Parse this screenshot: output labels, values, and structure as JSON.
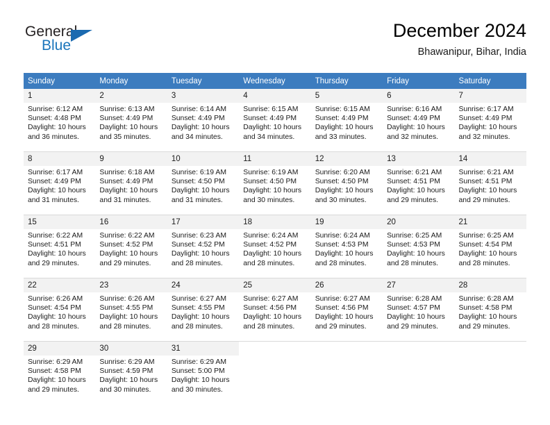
{
  "brand": {
    "word_general": "General",
    "word_blue": "Blue",
    "triangle_color": "#1b6ab0",
    "blue_color": "#1b75bb"
  },
  "header": {
    "title": "December 2024",
    "subtitle": "Bhawanipur, Bihar, India"
  },
  "theme": {
    "header_row_bg": "#3c7cbf",
    "daynum_bg": "#f2f2f2",
    "grid_line": "#d9d9d9",
    "text": "#1a1a1a"
  },
  "weekday_headers": [
    "Sunday",
    "Monday",
    "Tuesday",
    "Wednesday",
    "Thursday",
    "Friday",
    "Saturday"
  ],
  "labels": {
    "sunrise_prefix": "Sunrise:",
    "sunset_prefix": "Sunset:",
    "daylight_prefix": "Daylight:"
  },
  "weeks": [
    [
      {
        "day": "1",
        "sunrise": "Sunrise: 6:12 AM",
        "sunset": "Sunset: 4:48 PM",
        "daylight1": "Daylight: 10 hours",
        "daylight2": "and 36 minutes."
      },
      {
        "day": "2",
        "sunrise": "Sunrise: 6:13 AM",
        "sunset": "Sunset: 4:49 PM",
        "daylight1": "Daylight: 10 hours",
        "daylight2": "and 35 minutes."
      },
      {
        "day": "3",
        "sunrise": "Sunrise: 6:14 AM",
        "sunset": "Sunset: 4:49 PM",
        "daylight1": "Daylight: 10 hours",
        "daylight2": "and 34 minutes."
      },
      {
        "day": "4",
        "sunrise": "Sunrise: 6:15 AM",
        "sunset": "Sunset: 4:49 PM",
        "daylight1": "Daylight: 10 hours",
        "daylight2": "and 34 minutes."
      },
      {
        "day": "5",
        "sunrise": "Sunrise: 6:15 AM",
        "sunset": "Sunset: 4:49 PM",
        "daylight1": "Daylight: 10 hours",
        "daylight2": "and 33 minutes."
      },
      {
        "day": "6",
        "sunrise": "Sunrise: 6:16 AM",
        "sunset": "Sunset: 4:49 PM",
        "daylight1": "Daylight: 10 hours",
        "daylight2": "and 32 minutes."
      },
      {
        "day": "7",
        "sunrise": "Sunrise: 6:17 AM",
        "sunset": "Sunset: 4:49 PM",
        "daylight1": "Daylight: 10 hours",
        "daylight2": "and 32 minutes."
      }
    ],
    [
      {
        "day": "8",
        "sunrise": "Sunrise: 6:17 AM",
        "sunset": "Sunset: 4:49 PM",
        "daylight1": "Daylight: 10 hours",
        "daylight2": "and 31 minutes."
      },
      {
        "day": "9",
        "sunrise": "Sunrise: 6:18 AM",
        "sunset": "Sunset: 4:49 PM",
        "daylight1": "Daylight: 10 hours",
        "daylight2": "and 31 minutes."
      },
      {
        "day": "10",
        "sunrise": "Sunrise: 6:19 AM",
        "sunset": "Sunset: 4:50 PM",
        "daylight1": "Daylight: 10 hours",
        "daylight2": "and 31 minutes."
      },
      {
        "day": "11",
        "sunrise": "Sunrise: 6:19 AM",
        "sunset": "Sunset: 4:50 PM",
        "daylight1": "Daylight: 10 hours",
        "daylight2": "and 30 minutes."
      },
      {
        "day": "12",
        "sunrise": "Sunrise: 6:20 AM",
        "sunset": "Sunset: 4:50 PM",
        "daylight1": "Daylight: 10 hours",
        "daylight2": "and 30 minutes."
      },
      {
        "day": "13",
        "sunrise": "Sunrise: 6:21 AM",
        "sunset": "Sunset: 4:51 PM",
        "daylight1": "Daylight: 10 hours",
        "daylight2": "and 29 minutes."
      },
      {
        "day": "14",
        "sunrise": "Sunrise: 6:21 AM",
        "sunset": "Sunset: 4:51 PM",
        "daylight1": "Daylight: 10 hours",
        "daylight2": "and 29 minutes."
      }
    ],
    [
      {
        "day": "15",
        "sunrise": "Sunrise: 6:22 AM",
        "sunset": "Sunset: 4:51 PM",
        "daylight1": "Daylight: 10 hours",
        "daylight2": "and 29 minutes."
      },
      {
        "day": "16",
        "sunrise": "Sunrise: 6:22 AM",
        "sunset": "Sunset: 4:52 PM",
        "daylight1": "Daylight: 10 hours",
        "daylight2": "and 29 minutes."
      },
      {
        "day": "17",
        "sunrise": "Sunrise: 6:23 AM",
        "sunset": "Sunset: 4:52 PM",
        "daylight1": "Daylight: 10 hours",
        "daylight2": "and 28 minutes."
      },
      {
        "day": "18",
        "sunrise": "Sunrise: 6:24 AM",
        "sunset": "Sunset: 4:52 PM",
        "daylight1": "Daylight: 10 hours",
        "daylight2": "and 28 minutes."
      },
      {
        "day": "19",
        "sunrise": "Sunrise: 6:24 AM",
        "sunset": "Sunset: 4:53 PM",
        "daylight1": "Daylight: 10 hours",
        "daylight2": "and 28 minutes."
      },
      {
        "day": "20",
        "sunrise": "Sunrise: 6:25 AM",
        "sunset": "Sunset: 4:53 PM",
        "daylight1": "Daylight: 10 hours",
        "daylight2": "and 28 minutes."
      },
      {
        "day": "21",
        "sunrise": "Sunrise: 6:25 AM",
        "sunset": "Sunset: 4:54 PM",
        "daylight1": "Daylight: 10 hours",
        "daylight2": "and 28 minutes."
      }
    ],
    [
      {
        "day": "22",
        "sunrise": "Sunrise: 6:26 AM",
        "sunset": "Sunset: 4:54 PM",
        "daylight1": "Daylight: 10 hours",
        "daylight2": "and 28 minutes."
      },
      {
        "day": "23",
        "sunrise": "Sunrise: 6:26 AM",
        "sunset": "Sunset: 4:55 PM",
        "daylight1": "Daylight: 10 hours",
        "daylight2": "and 28 minutes."
      },
      {
        "day": "24",
        "sunrise": "Sunrise: 6:27 AM",
        "sunset": "Sunset: 4:55 PM",
        "daylight1": "Daylight: 10 hours",
        "daylight2": "and 28 minutes."
      },
      {
        "day": "25",
        "sunrise": "Sunrise: 6:27 AM",
        "sunset": "Sunset: 4:56 PM",
        "daylight1": "Daylight: 10 hours",
        "daylight2": "and 28 minutes."
      },
      {
        "day": "26",
        "sunrise": "Sunrise: 6:27 AM",
        "sunset": "Sunset: 4:56 PM",
        "daylight1": "Daylight: 10 hours",
        "daylight2": "and 29 minutes."
      },
      {
        "day": "27",
        "sunrise": "Sunrise: 6:28 AM",
        "sunset": "Sunset: 4:57 PM",
        "daylight1": "Daylight: 10 hours",
        "daylight2": "and 29 minutes."
      },
      {
        "day": "28",
        "sunrise": "Sunrise: 6:28 AM",
        "sunset": "Sunset: 4:58 PM",
        "daylight1": "Daylight: 10 hours",
        "daylight2": "and 29 minutes."
      }
    ],
    [
      {
        "day": "29",
        "sunrise": "Sunrise: 6:29 AM",
        "sunset": "Sunset: 4:58 PM",
        "daylight1": "Daylight: 10 hours",
        "daylight2": "and 29 minutes."
      },
      {
        "day": "30",
        "sunrise": "Sunrise: 6:29 AM",
        "sunset": "Sunset: 4:59 PM",
        "daylight1": "Daylight: 10 hours",
        "daylight2": "and 30 minutes."
      },
      {
        "day": "31",
        "sunrise": "Sunrise: 6:29 AM",
        "sunset": "Sunset: 5:00 PM",
        "daylight1": "Daylight: 10 hours",
        "daylight2": "and 30 minutes."
      },
      {
        "day": "",
        "sunrise": "",
        "sunset": "",
        "daylight1": "",
        "daylight2": ""
      },
      {
        "day": "",
        "sunrise": "",
        "sunset": "",
        "daylight1": "",
        "daylight2": ""
      },
      {
        "day": "",
        "sunrise": "",
        "sunset": "",
        "daylight1": "",
        "daylight2": ""
      },
      {
        "day": "",
        "sunrise": "",
        "sunset": "",
        "daylight1": "",
        "daylight2": ""
      }
    ]
  ]
}
